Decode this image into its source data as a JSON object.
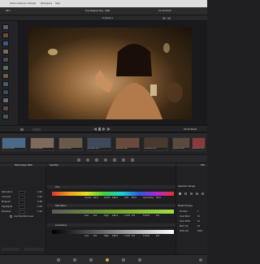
{
  "menu": {
    "apple": "",
    "app": "DaVinci Resolve",
    "items": [
      "Fairlight",
      "Workspace",
      "Help"
    ]
  },
  "titlebar": {
    "title": "One Magical Day - RAW",
    "left_label": "89%",
    "center_label": "Timeline 1",
    "right_label": "01:20:00:00"
  },
  "viewer": {
    "timecode": "01:03:28:19"
  },
  "clips": [
    {
      "label": "Mountain ARRI",
      "color": "#4a6a8a"
    },
    {
      "label": "Mountain ARRI",
      "color": "#7d6a5a"
    },
    {
      "label": "Mountain ARRI",
      "color": "#6a5a4a"
    },
    {
      "label": "Mountain RED",
      "color": "#3e4a5a"
    },
    {
      "label": "Mountain RED",
      "color": "#6a4a3a"
    },
    {
      "label": "Mountain RED",
      "color": "#4a3a2e"
    },
    {
      "label": "Mountain RED",
      "color": "#5a4a3e"
    },
    {
      "label": "Mountain RED",
      "color": "#8a3a3a"
    },
    {
      "label": "Mountain RED",
      "color": "#7a5a4e"
    }
  ],
  "left_panel": {
    "title": "Blackmagic RAW",
    "rows": [
      {
        "label": "Saturation",
        "value": "1.00"
      },
      {
        "label": "Contrast",
        "value": "1.00"
      },
      {
        "label": "Midpoint",
        "value": "0.38"
      },
      {
        "label": "Highlights",
        "value": "1.00"
      },
      {
        "label": "Shadows",
        "value": "1.00"
      }
    ],
    "checkbox_label": "Use Video Black Level"
  },
  "qualifier": {
    "title": "Qualifier",
    "hue": {
      "title": "Hue",
      "values": [
        "50.0",
        "100.0",
        "50.0",
        "50.0"
      ],
      "fields": [
        "Center",
        "Width",
        "Soft",
        "Symmetry"
      ]
    },
    "sat": {
      "title": "Saturation",
      "values": [
        "0.0",
        "100.0",
        "0.0",
        "0.0"
      ],
      "fields": [
        "Low",
        "High",
        "L.Soft",
        "H.Soft"
      ]
    },
    "lum": {
      "title": "Luminance",
      "values": [
        "0.0",
        "100.0",
        "0.0",
        "0.0"
      ],
      "fields": [
        "Low",
        "High",
        "L.Soft",
        "H.Soft"
      ]
    }
  },
  "right_panel": {
    "selection_title": "Selection Range",
    "matte_title": "Matte Finesse",
    "rows": [
      {
        "label": "Pre-Filter",
        "value": "0"
      },
      {
        "label": "Clean Black",
        "value": "0.0"
      },
      {
        "label": "Clean White",
        "value": "0.0"
      },
      {
        "label": "Black Clip",
        "value": "0.0"
      },
      {
        "label": "White Clip",
        "value": "100.0"
      }
    ],
    "mode": "HSL"
  },
  "colors": {
    "accent": "#d4aa44",
    "red_clip": "#8a3a3a"
  }
}
